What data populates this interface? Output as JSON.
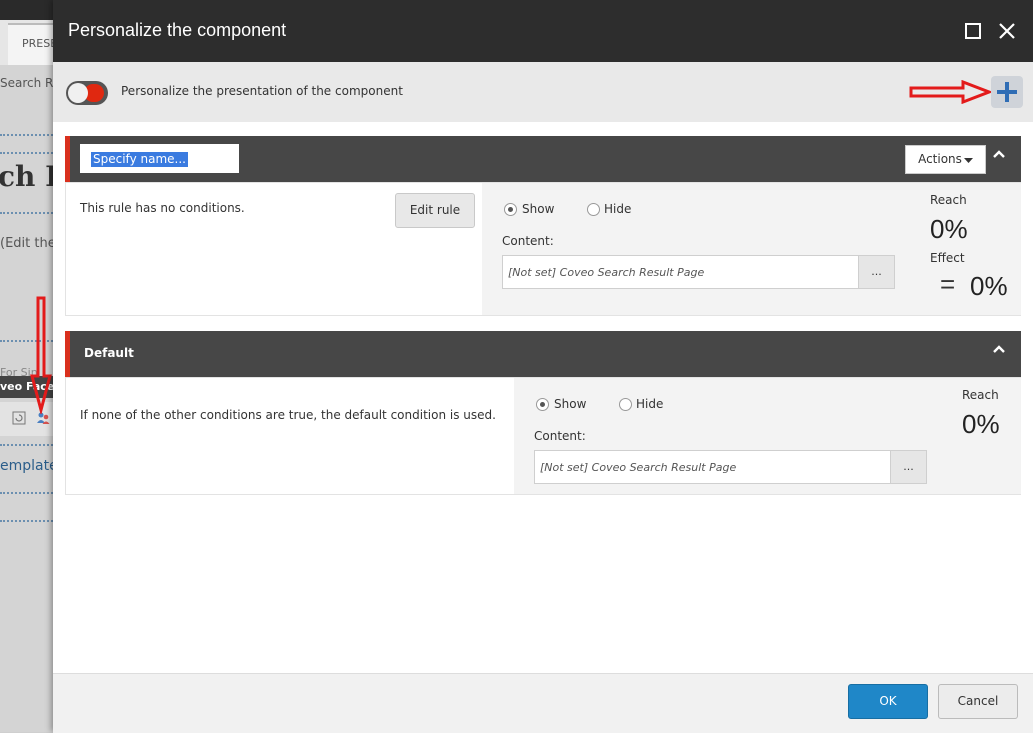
{
  "background_page": {
    "tab_label": "PRESE",
    "breadcrumb": "Search Re",
    "heading_fragment": "ch R",
    "edit_hint": "(Edit the",
    "facet_line": "For Sin",
    "facet_title": "veo Face",
    "template_link": "emplate"
  },
  "dialog": {
    "title": "Personalize the component",
    "personalize_toggle_label": "Personalize the presentation of the component",
    "toggle_on": false,
    "colors": {
      "accent_red": "#d9301e",
      "primary_blue": "#1f87c8",
      "header_dark": "#2d2d2d"
    }
  },
  "rule1": {
    "name_placeholder": "Specify name...",
    "actions_label": "Actions",
    "condition_text": "This rule has no conditions.",
    "edit_rule_label": "Edit rule",
    "show_label": "Show",
    "hide_label": "Hide",
    "selected_option": "Show",
    "content_label": "Content:",
    "content_value": "[Not set] Coveo Search Result Page",
    "browse_label": "...",
    "reach_label": "Reach",
    "reach_value": "0%",
    "effect_label": "Effect",
    "effect_symbol": "=",
    "effect_value": "0%"
  },
  "default_rule": {
    "title": "Default",
    "condition_text": "If none of the other conditions are true, the default condition is used.",
    "show_label": "Show",
    "hide_label": "Hide",
    "selected_option": "Show",
    "content_label": "Content:",
    "content_value": "[Not set] Coveo Search Result Page",
    "browse_label": "...",
    "reach_label": "Reach",
    "reach_value": "0%"
  },
  "footer": {
    "ok_label": "OK",
    "cancel_label": "Cancel"
  }
}
